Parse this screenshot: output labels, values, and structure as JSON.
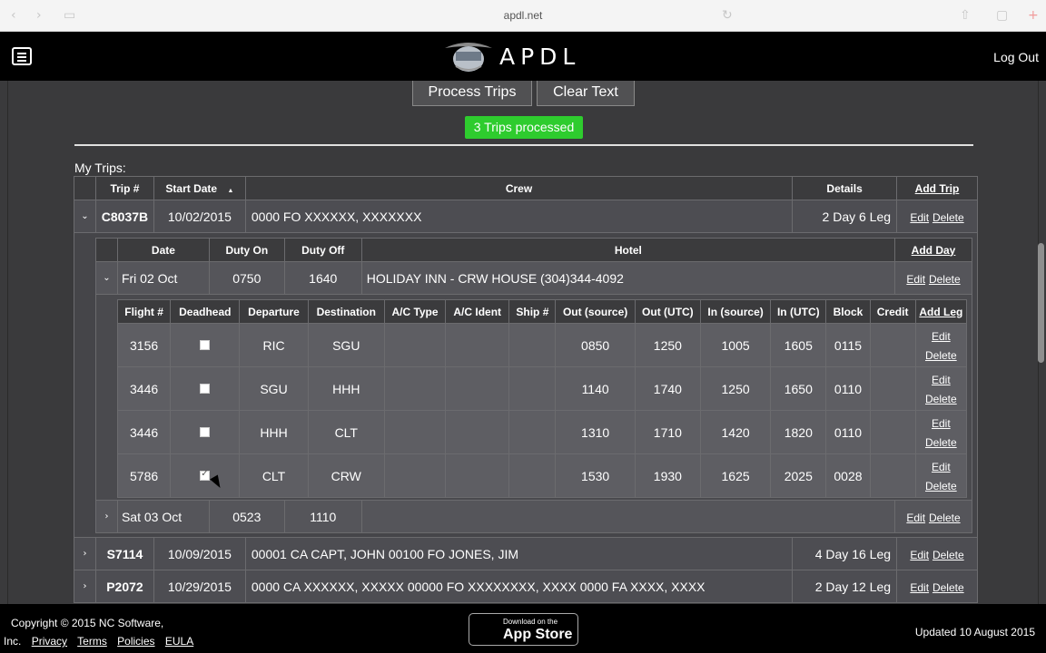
{
  "browser": {
    "url": "apdl.net"
  },
  "header": {
    "logo_text": "APDL",
    "logout": "Log Out"
  },
  "actions": {
    "process": "Process Trips",
    "clear": "Clear Text"
  },
  "status": "3 Trips processed",
  "section_title": "My Trips:",
  "trips": {
    "headers": [
      "Trip #",
      "Start Date",
      "Crew",
      "Details",
      "Add Trip"
    ],
    "sort_indicator": "▲",
    "rows": [
      {
        "trip": "C8037B",
        "start": "10/02/2015",
        "crew": "0000 FO XXXXXX, XXXXXXX",
        "details": "2 Day 6 Leg",
        "expanded": true
      },
      {
        "trip": "S7114",
        "start": "10/09/2015",
        "crew": "00001 CA CAPT, JOHN 00100 FO JONES, JIM",
        "details": "4 Day 16 Leg",
        "expanded": false
      },
      {
        "trip": "P2072",
        "start": "10/29/2015",
        "crew": "0000 CA XXXXXX, XXXXX 00000 FO XXXXXXXX, XXXX 0000 FA XXXX, XXXX",
        "details": "2 Day 12 Leg",
        "expanded": false
      }
    ]
  },
  "duty": {
    "headers": [
      "Date",
      "Duty On",
      "Duty Off",
      "Hotel",
      "Add Day"
    ],
    "rows": [
      {
        "date": "Fri 02 Oct",
        "on": "0750",
        "off": "1640",
        "hotel": "HOLIDAY INN - CRW HOUSE (304)344-4092",
        "expanded": true
      },
      {
        "date": "Sat 03 Oct",
        "on": "0523",
        "off": "1110",
        "hotel": "",
        "expanded": false
      }
    ]
  },
  "legs": {
    "headers": [
      "Flight #",
      "Deadhead",
      "Departure",
      "Destination",
      "A/C Type",
      "A/C Ident",
      "Ship #",
      "Out (source)",
      "Out (UTC)",
      "In (source)",
      "In (UTC)",
      "Block",
      "Credit",
      "Add Leg"
    ],
    "rows": [
      {
        "flight": "3156",
        "deadhead": false,
        "dep": "RIC",
        "dest": "SGU",
        "actype": "",
        "acident": "",
        "ship": "",
        "out_src": "0850",
        "out_utc": "1250",
        "in_src": "1005",
        "in_utc": "1605",
        "block": "0115",
        "credit": ""
      },
      {
        "flight": "3446",
        "deadhead": false,
        "dep": "SGU",
        "dest": "HHH",
        "actype": "",
        "acident": "",
        "ship": "",
        "out_src": "1140",
        "out_utc": "1740",
        "in_src": "1250",
        "in_utc": "1650",
        "block": "0110",
        "credit": ""
      },
      {
        "flight": "3446",
        "deadhead": false,
        "dep": "HHH",
        "dest": "CLT",
        "actype": "",
        "acident": "",
        "ship": "",
        "out_src": "1310",
        "out_utc": "1710",
        "in_src": "1420",
        "in_utc": "1820",
        "block": "0110",
        "credit": ""
      },
      {
        "flight": "5786",
        "deadhead": true,
        "dep": "CLT",
        "dest": "CRW",
        "actype": "",
        "acident": "",
        "ship": "",
        "out_src": "1530",
        "out_utc": "1930",
        "in_src": "1625",
        "in_utc": "2025",
        "block": "0028",
        "credit": ""
      }
    ]
  },
  "row_actions": {
    "edit": "Edit",
    "delete": "Delete"
  },
  "footer": {
    "copyright_line1": "Copyright © 2015 NC Software,",
    "copyright_line2": "Inc.",
    "links": [
      "Privacy",
      "Terms",
      "Policies",
      "EULA"
    ],
    "appstore_small": "Download on the",
    "appstore_big": "App Store",
    "updated": "Updated 10 August 2015"
  }
}
